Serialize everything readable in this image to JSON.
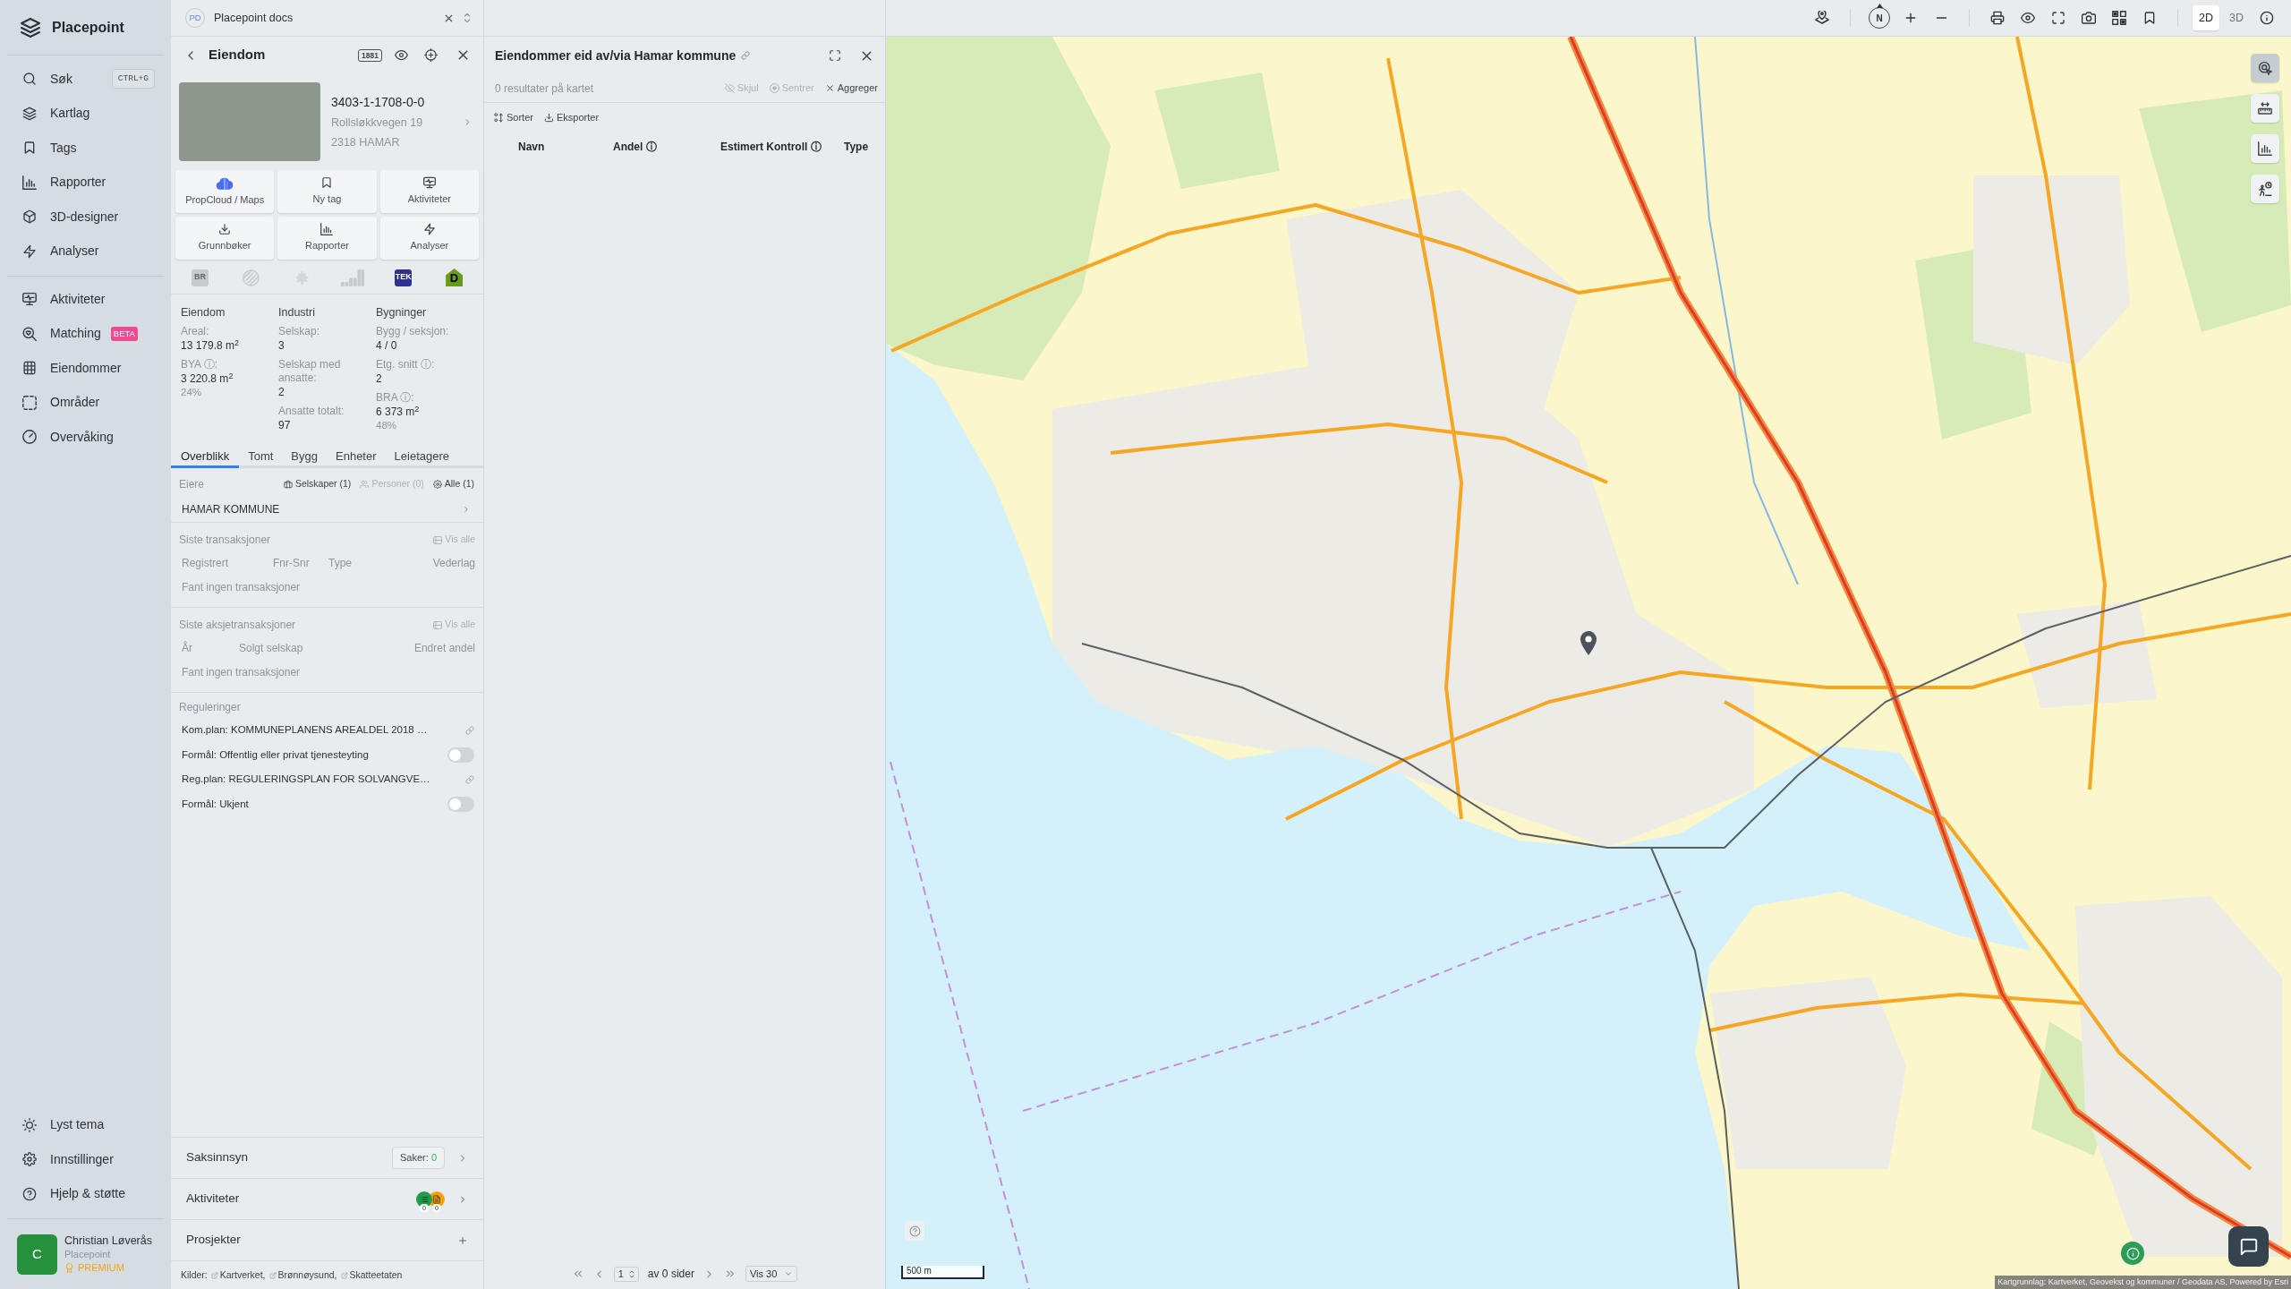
{
  "sidebar": {
    "brand": "Placepoint",
    "main_items": [
      {
        "label": "Søk",
        "shortcut": "CTRL+G"
      },
      {
        "label": "Kartlag"
      },
      {
        "label": "Tags"
      },
      {
        "label": "Rapporter"
      },
      {
        "label": "3D-designer"
      },
      {
        "label": "Analyser"
      }
    ],
    "work_items": [
      {
        "label": "Aktiviteter"
      },
      {
        "label": "Matching",
        "badge": "BETA"
      },
      {
        "label": "Eiendommer"
      },
      {
        "label": "Områder"
      },
      {
        "label": "Overvåking"
      }
    ],
    "bottom_items": [
      {
        "label": "Lyst tema"
      },
      {
        "label": "Innstillinger"
      },
      {
        "label": "Hjelp & støtte"
      }
    ],
    "user": {
      "initial": "C",
      "name": "Christian Løverås",
      "organization": "Placepoint",
      "plan": "PREMIUM"
    }
  },
  "doc_tab": {
    "initials": "PD",
    "title": "Placepoint docs"
  },
  "property": {
    "title": "Eiendom",
    "directory_logo": "1881",
    "id": "3403-1-1708-0-0",
    "address": "Rollsløkkvegen 19",
    "postal": "2318 HAMAR",
    "actions": [
      "PropCloud / Maps",
      "Ny tag",
      "Aktiviteter",
      "Grunnbøker",
      "Rapporter",
      "Analyser"
    ],
    "badges": [
      {
        "kind": "tile",
        "label": "BR",
        "active": false
      },
      {
        "kind": "stripes",
        "active": false
      },
      {
        "kind": "leaf",
        "active": false
      },
      {
        "kind": "steps",
        "active": false
      },
      {
        "kind": "tile",
        "label": "TEK",
        "active": true
      },
      {
        "kind": "house",
        "label": "D",
        "active": true
      }
    ],
    "stats": [
      {
        "title": "Eiendom",
        "fields": [
          {
            "label": "Areal:",
            "value": "13 179.8 m$^{2}$"
          },
          {
            "label": "BYA ⓘ:",
            "value": "3 220.8 m$^{2}$",
            "note": "24%"
          }
        ]
      },
      {
        "title": "Industri",
        "fields": [
          {
            "label": "Selskap:",
            "value": "3"
          },
          {
            "label": "Selskap med ansatte:",
            "value": "2"
          },
          {
            "label": "Ansatte totalt:",
            "value": "97"
          }
        ]
      },
      {
        "title": "Bygninger",
        "fields": [
          {
            "label": "Bygg / seksjon:",
            "value": "4 / 0"
          },
          {
            "label": "Etg. snitt ⓘ:",
            "value": "2"
          },
          {
            "label": "BRA ⓘ:",
            "value": "6 373 m$^{2}$",
            "note": "48%"
          }
        ]
      }
    ],
    "tabs": [
      {
        "label": "Overblikk",
        "selected": true
      },
      {
        "label": "Tomt",
        "selected": false
      },
      {
        "label": "Bygg",
        "selected": false
      },
      {
        "label": "Enheter",
        "selected": false
      },
      {
        "label": "Leietagere",
        "selected": false
      }
    ],
    "owners": {
      "label": "Eiere",
      "filters": [
        {
          "label": "Selskaper (1)",
          "disabled": false
        },
        {
          "label": "Personer (0)",
          "disabled": true
        },
        {
          "label": "Alle (1)",
          "disabled": false
        }
      ],
      "rows": [
        "HAMAR KOMMUNE"
      ]
    },
    "transactions": {
      "title": "Siste transaksjoner",
      "link": "Vis alle",
      "columns": [
        "Registrert",
        "Fnr-Snr",
        "Type",
        "Vederlag"
      ],
      "empty": "Fant ingen transaksjoner"
    },
    "share_transactions": {
      "title": "Siste aksjetransaksjoner",
      "link": "Vis alle",
      "columns": [
        "År",
        "Solgt selskap",
        "Endret andel"
      ],
      "empty": "Fant ingen transaksjoner"
    },
    "regulations": {
      "title": "Reguleringer",
      "items": [
        {
          "kind": "plan",
          "text": "Kom.plan: KOMMUNEPLANENS AREALDEL 2018 …"
        },
        {
          "kind": "purpose",
          "text": "Formål: Offentlig eller privat tjenesteyting",
          "on": false
        },
        {
          "kind": "plan",
          "text": "Reg.plan: REGULERINGSPLAN FOR SOLVANGVE…"
        },
        {
          "kind": "purpose",
          "text": "Formål: Ukjent",
          "on": false
        }
      ]
    },
    "sections": [
      {
        "kind": "cases",
        "label": "Saksinnsyn",
        "chip_label": "Saker:",
        "chip_value": "0"
      },
      {
        "kind": "activities",
        "label": "Aktiviteter",
        "counts": [
          "0",
          "0"
        ]
      },
      {
        "kind": "projects",
        "label": "Prosjekter"
      }
    ],
    "sources": {
      "label": "Kilder:",
      "links": [
        "Kartverket,",
        "Brønnøysund,",
        "Skatteetaten"
      ]
    }
  },
  "middle": {
    "title": "Eiendommer eid av/via Hamar kommune",
    "result_count": "0 resultater på kartet",
    "actions": [
      {
        "label": "Skjul",
        "disabled": true
      },
      {
        "label": "Sentrer",
        "disabled": true
      },
      {
        "label": "Aggreger",
        "disabled": false
      }
    ],
    "tools": [
      "Sorter",
      "Eksporter"
    ],
    "columns": [
      "Navn",
      "Andel ⓘ",
      "Estimert Kontroll ⓘ",
      "Type"
    ],
    "pager": {
      "page": "1",
      "summary": "av 0 sider",
      "page_size": "Vis 30"
    }
  },
  "map": {
    "compass": "N",
    "modes": [
      {
        "label": "2D",
        "selected": true
      },
      {
        "label": "3D",
        "selected": false
      }
    ],
    "tools": [
      {
        "selected": true
      },
      {
        "selected": false
      },
      {
        "selected": false
      },
      {
        "selected": false
      }
    ],
    "scale": "500 m",
    "attribution": "Kartgrunnlag: Kartverket, Geovekst og kommuner / Geodata AS, Powered by Esri"
  }
}
